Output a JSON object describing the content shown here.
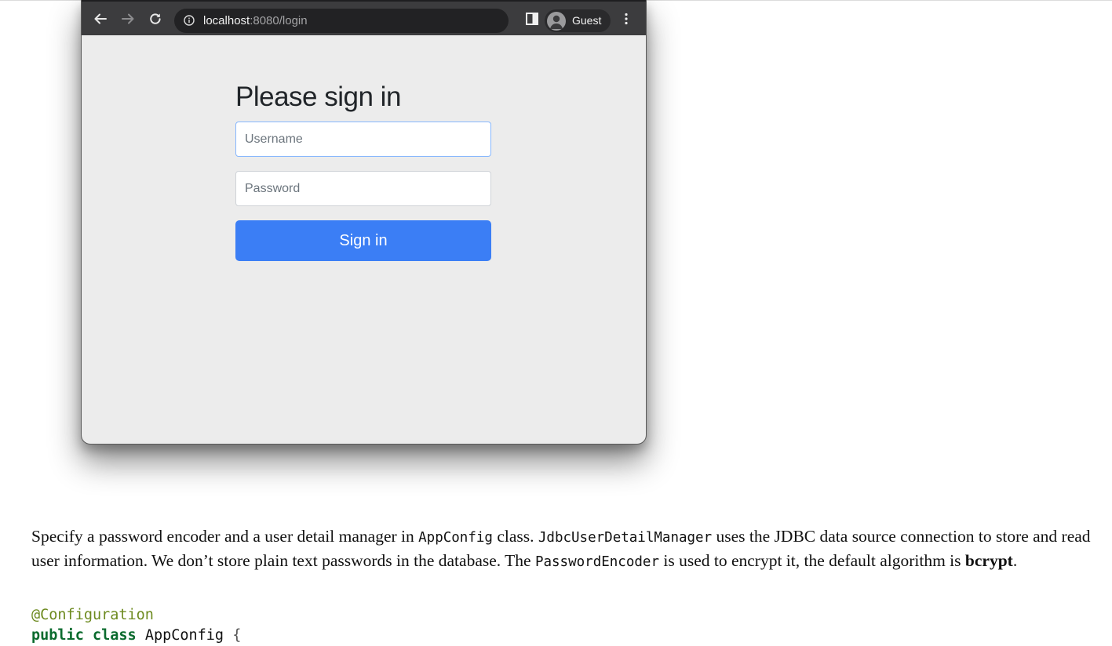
{
  "browser": {
    "address": {
      "host": "localhost",
      "path": ":8080/login"
    },
    "profile_label": "Guest",
    "icons": [
      "back-arrow-icon",
      "forward-arrow-icon",
      "reload-icon",
      "info-icon",
      "side-panel-icon",
      "profile-icon",
      "more-vert-icon"
    ]
  },
  "login": {
    "title": "Please sign in",
    "username_placeholder": "Username",
    "password_placeholder": "Password",
    "button_label": "Sign in",
    "button_color": "#3b7ef5"
  },
  "article": {
    "p1": "Specify a password encoder and a user detail manager in ",
    "code1": "AppConfig",
    "p2": " class. ",
    "code2": "JdbcUserDetailManager",
    "p3": " uses the JDBC data source connection to store and read user information. We don’t store plain text passwords in the database. The ",
    "code3": "PasswordEncoder",
    "p4": " is used to encrypt it, the default algorithm is ",
    "bold": "bcrypt",
    "p5": "."
  },
  "code": {
    "annotation": "@Configuration",
    "keyword1": "public",
    "keyword2": "class",
    "class_name": "AppConfig",
    "brace": "{"
  }
}
